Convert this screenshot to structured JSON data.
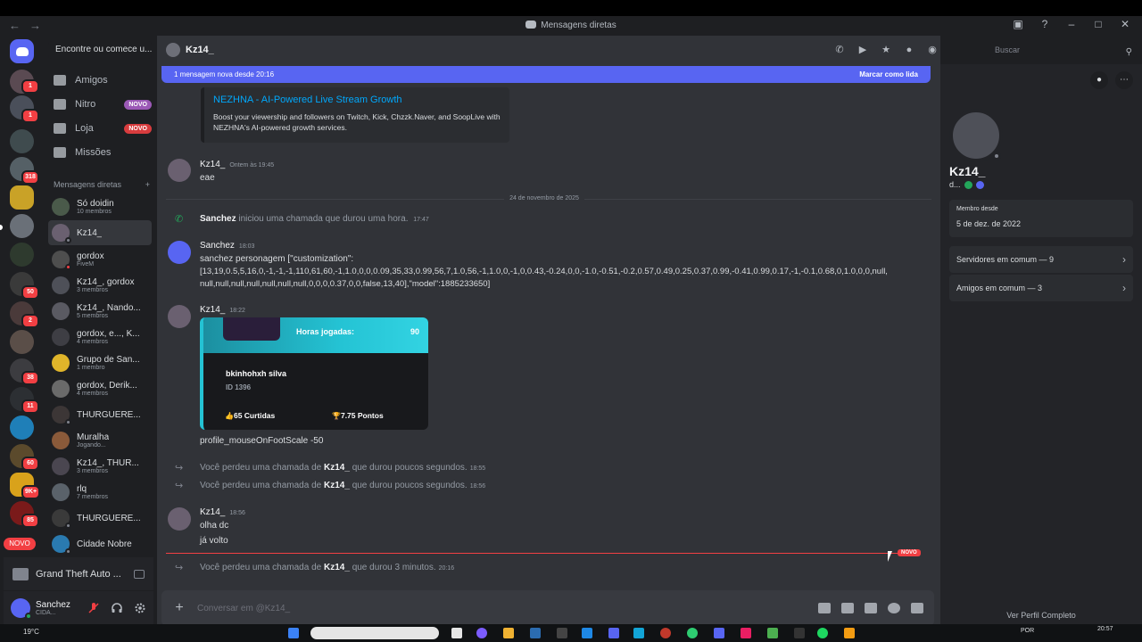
{
  "window": {
    "title": "Mensagens diretas"
  },
  "dm_search": {
    "placeholder": "Encontre ou comece u..."
  },
  "top_nav": [
    {
      "label": "Amigos",
      "badge": ""
    },
    {
      "label": "Nitro",
      "badge": "NOVO"
    },
    {
      "label": "Loja",
      "badge": "NOVO"
    },
    {
      "label": "Missões",
      "badge": ""
    }
  ],
  "dm_section": {
    "title": "Mensagens diretas",
    "add": "+"
  },
  "dm_list": [
    {
      "name": "Só doidin",
      "sub": "10 membros"
    },
    {
      "name": "Kz14_",
      "sub": ""
    },
    {
      "name": "gordox",
      "sub": "FiveM"
    },
    {
      "name": "Kz14_, gordox",
      "sub": "3 membros"
    },
    {
      "name": "Kz14_, Nando...",
      "sub": "5 membros"
    },
    {
      "name": "gordox, e..., K...",
      "sub": "4 membros"
    },
    {
      "name": "Grupo de San...",
      "sub": "1 membro"
    },
    {
      "name": "gordox, Derik...",
      "sub": "4 membros"
    },
    {
      "name": "THURGUERE...",
      "sub": ""
    },
    {
      "name": "Muralha",
      "sub": "Jogando..."
    },
    {
      "name": "Kz14_, THUR...",
      "sub": "3 membros"
    },
    {
      "name": "rlq",
      "sub": "7 membros"
    },
    {
      "name": "THURGUERE...",
      "sub": ""
    },
    {
      "name": "Cidade Nobre",
      "sub": ""
    }
  ],
  "guild_badges": [
    "1",
    "1",
    "318",
    "50",
    "2",
    "38",
    "11",
    "60",
    "9K+",
    "85"
  ],
  "guild_novo": "NOVO",
  "activity": {
    "game": "Grand Theft Auto ..."
  },
  "user": {
    "name": "Sanchez",
    "status": "CIDA..."
  },
  "chat": {
    "header_name": "Kz14_",
    "search_placeholder": "Buscar",
    "new_bar": {
      "text": "1 mensagem nova desde 20:16",
      "action": "Marcar como lida"
    },
    "embed": {
      "title": "NEZHNA - AI-Powered Live Stream Growth",
      "desc": "Boost your viewership and followers on Twitch, Kick, Chzzk.Naver, and SoopLive with NEZHNA's AI-powered growth services."
    },
    "msg1": {
      "author": "Kz14_",
      "time": "Ontem às 19:45",
      "text": "eae"
    },
    "date_divider": "24 de novembro de 2025",
    "call1": {
      "author": "Sanchez",
      "text": "iniciou uma chamada que durou uma hora.",
      "time": "17:47"
    },
    "msg2": {
      "author": "Sanchez",
      "time": "18:03",
      "line1": "sanchez personagem [\"customization\":",
      "line2": "[13,19,0.5,5,16,0,-1,-1,-1,110,61,60,-1,1.0,0,0,0.09,35,33,0.99,56,7,1.0,56,-1,1.0,0,-1,0,0.43,-0.24,0,0,-1.0,-0.51,-0.2,0.57,0.49,0.25,0.37,0.99,-0.41,0.99,0.17,-1,-0.1,0.68,0,1.0,0,0,null,",
      "line3": "null,null,null,null,null,null,null,0,0,0,0.37,0,0,false,13,40],\"model\":1885233650]"
    },
    "msg3": {
      "author": "Kz14_",
      "time": "18:22"
    },
    "card": {
      "hours_label": "Horas jogadas:",
      "hours_value": "90",
      "player": "bkinhohxh silva",
      "id": "ID 1396",
      "likes": "65 Curtidas",
      "points": "7.75 Pontos"
    },
    "msg3_text": "profile_mouseOnFootScale -50",
    "missed1": {
      "pre": "Você perdeu uma chamada de",
      "who": "Kz14_",
      "post": "que durou poucos segundos.",
      "time": "18:55"
    },
    "missed2": {
      "pre": "Você perdeu uma chamada de",
      "who": "Kz14_",
      "post": "que durou poucos segundos.",
      "time": "18:56"
    },
    "msg4": {
      "author": "Kz14_",
      "time": "18:56",
      "line1": "olha dc",
      "line2": "já volto"
    },
    "new_tag": "NOVO",
    "missed3": {
      "pre": "Você perdeu uma chamada de",
      "who": "Kz14_",
      "post": "que durou 3 minutos.",
      "time": "20:16"
    },
    "composer_placeholder": "Conversar em @Kz14_"
  },
  "profile": {
    "name": "Kz14_",
    "tag": "d...",
    "member_since_label": "Membro desde",
    "member_since": "5 de dez. de 2022",
    "servers_common": "Servidores em comum — 9",
    "friends_common": "Amigos em comum — 3",
    "full_profile": "Ver Perfil Completo"
  },
  "taskbar": {
    "weather": "19°C",
    "lang": "POR",
    "time": "20:57"
  },
  "colors": {
    "accent": "#5865f2",
    "danger": "#f23f43",
    "card_cyan": "#24c3d4",
    "link": "#00a8fc"
  }
}
